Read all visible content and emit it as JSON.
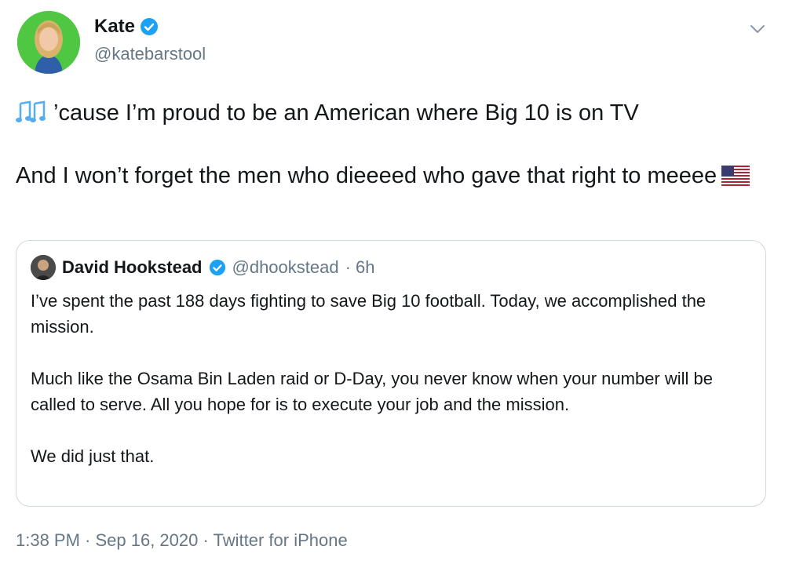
{
  "tweet": {
    "author_name": "Kate",
    "author_handle": "@katebarstool",
    "line1": "’cause I’m proud to be an American where Big 10 is on TV",
    "line2": "And I won’t forget the men who dieeeed who gave that right to meeee",
    "timestamp": "1:38 PM · Sep 16, 2020 · Twitter for iPhone",
    "icons": {
      "music": "musical-notes-icon",
      "flag": "us-flag-icon",
      "verified": "verified-badge-icon",
      "menu": "chevron-down-icon"
    }
  },
  "quote": {
    "author_name": "David Hookstead",
    "author_handle": "@dhookstead",
    "age": "· 6h",
    "p1": "I’ve spent the past 188 days fighting to save Big 10 football. Today, we accomplished the mission.",
    "p2": "Much like the Osama Bin Laden raid or D-Day, you never know when your number will be called to serve. All you hope for is to execute your job and the mission.",
    "p3": "We did just that."
  },
  "colors": {
    "verified": "#1da1f2",
    "secondary_text": "#657786",
    "border": "#cfd9de"
  }
}
